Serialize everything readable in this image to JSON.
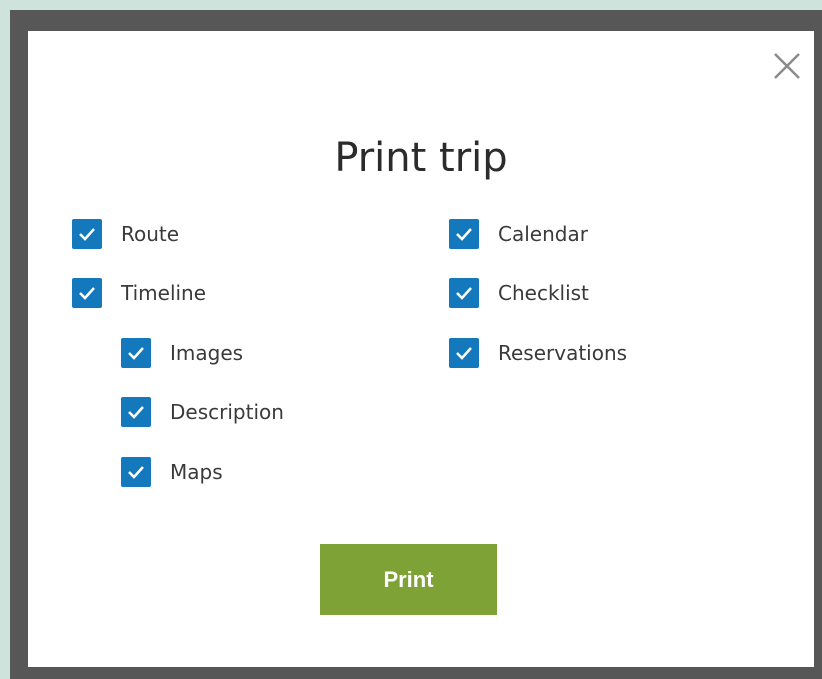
{
  "dialog": {
    "title": "Print trip",
    "close_icon": "close-icon",
    "options_left": [
      {
        "label": "Route",
        "checked": true
      },
      {
        "label": "Timeline",
        "checked": true
      },
      {
        "label": "Images",
        "checked": true,
        "indented": true
      },
      {
        "label": "Description",
        "checked": true,
        "indented": true
      },
      {
        "label": "Maps",
        "checked": true,
        "indented": true
      }
    ],
    "options_right": [
      {
        "label": "Calendar",
        "checked": true
      },
      {
        "label": "Checklist",
        "checked": true
      },
      {
        "label": "Reservations",
        "checked": true
      }
    ],
    "print_label": "Print"
  },
  "colors": {
    "checkbox": "#1478bd",
    "print_button": "#7fa237",
    "backdrop": "#575757"
  }
}
